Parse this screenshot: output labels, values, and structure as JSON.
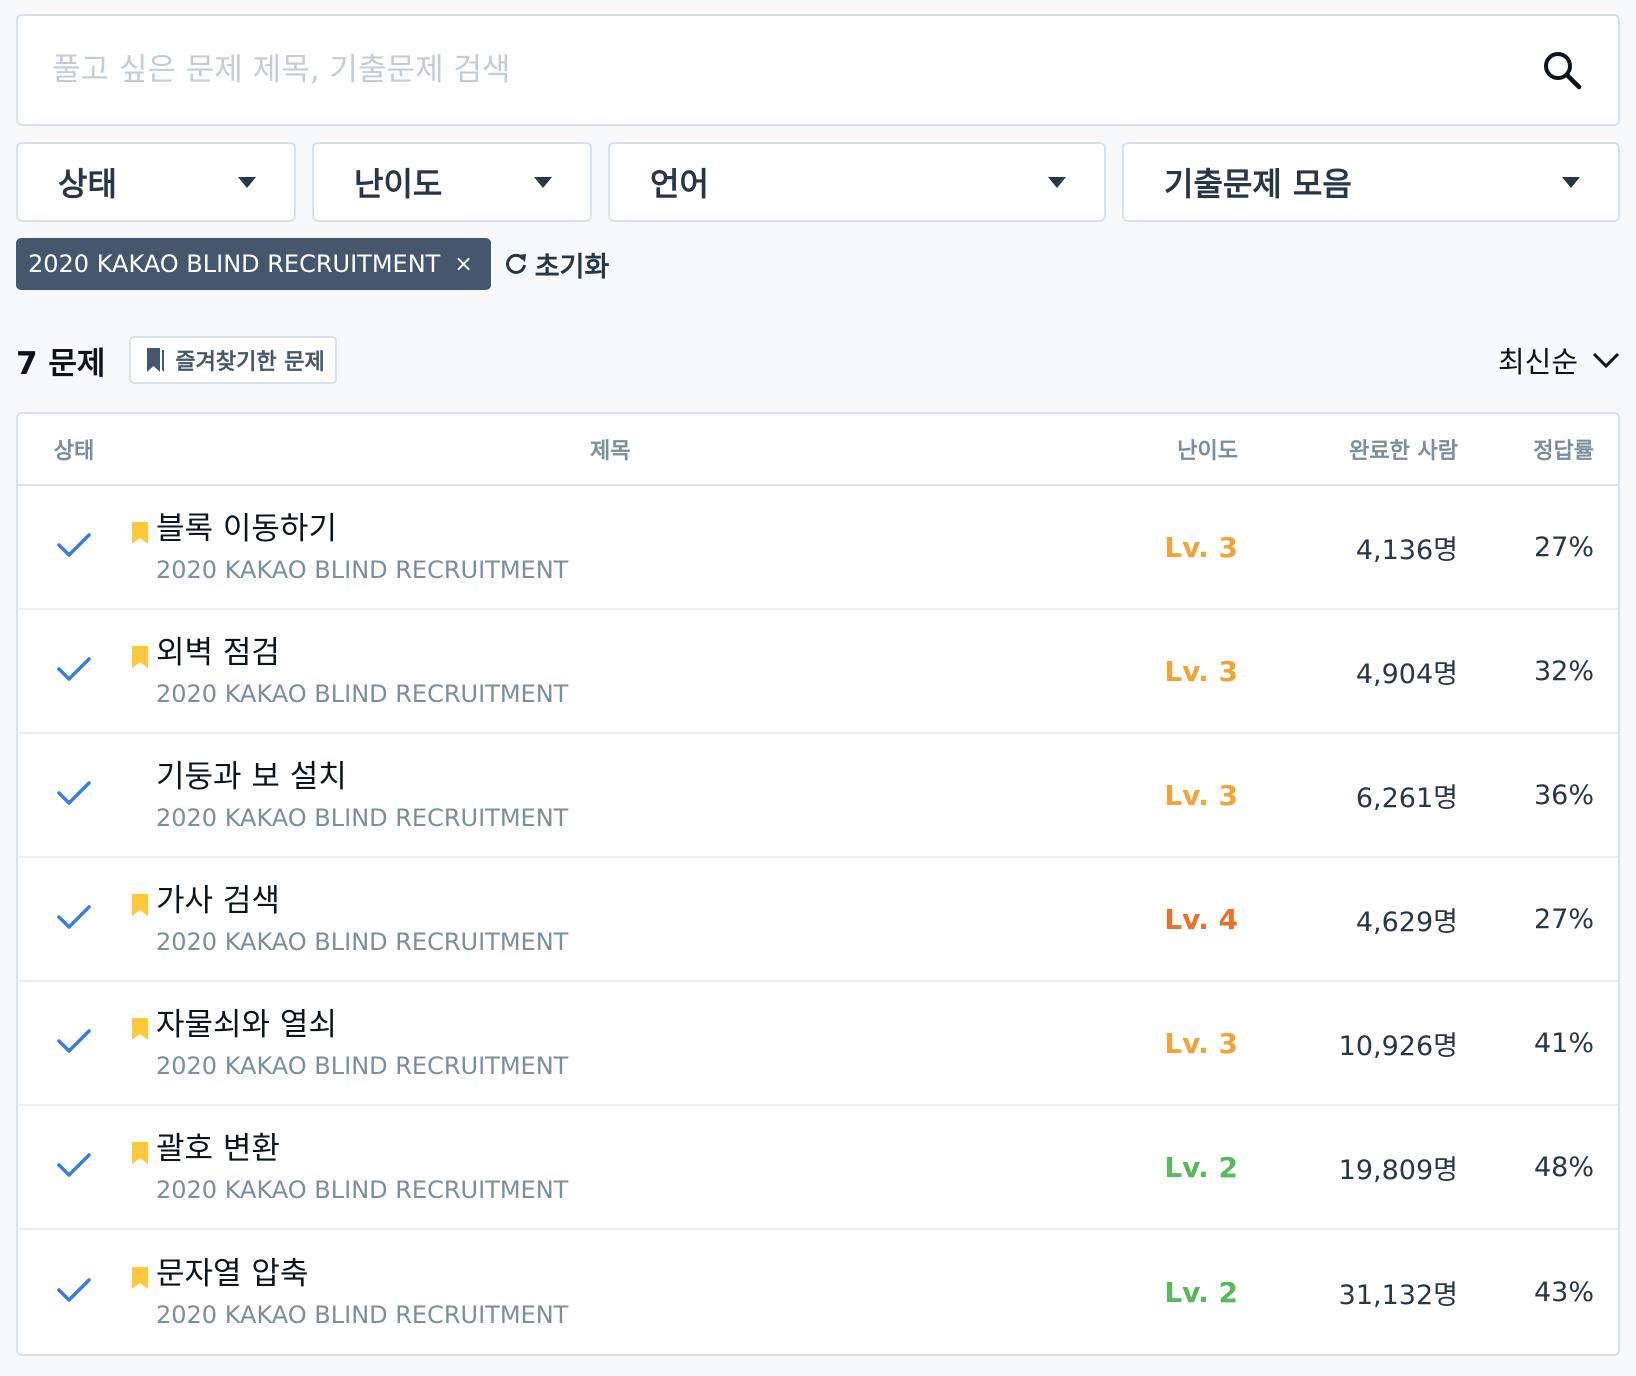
{
  "search": {
    "placeholder": "풀고 싶은 문제 제목, 기출문제 검색"
  },
  "filters": {
    "status": "상태",
    "level": "난이도",
    "language": "언어",
    "past_exams": "기출문제 모음"
  },
  "chip": {
    "label": "2020 KAKAO BLIND RECRUITMENT",
    "remove": "×"
  },
  "reset_label": "초기화",
  "summary": {
    "count": "7 문제",
    "favorites": "즐겨찾기한 문제",
    "sort": "최신순"
  },
  "table": {
    "headers": {
      "status": "상태",
      "title": "제목",
      "level": "난이도",
      "completed": "완료한 사람",
      "rate": "정답률"
    },
    "rows": [
      {
        "title": "블록 이동하기",
        "category": "2020 KAKAO BLIND RECRUITMENT",
        "level": "Lv. 3",
        "completed": "4,136명",
        "rate": "27%",
        "bookmarked": true,
        "level_color": "#f0a53b"
      },
      {
        "title": "외벽 점검",
        "category": "2020 KAKAO BLIND RECRUITMENT",
        "level": "Lv. 3",
        "completed": "4,904명",
        "rate": "32%",
        "bookmarked": true,
        "level_color": "#f0a53b"
      },
      {
        "title": "기둥과 보 설치",
        "category": "2020 KAKAO BLIND RECRUITMENT",
        "level": "Lv. 3",
        "completed": "6,261명",
        "rate": "36%",
        "bookmarked": false,
        "level_color": "#f0a53b"
      },
      {
        "title": "가사 검색",
        "category": "2020 KAKAO BLIND RECRUITMENT",
        "level": "Lv. 4",
        "completed": "4,629명",
        "rate": "27%",
        "bookmarked": true,
        "level_color": "#e8712d"
      },
      {
        "title": "자물쇠와 열쇠",
        "category": "2020 KAKAO BLIND RECRUITMENT",
        "level": "Lv. 3",
        "completed": "10,926명",
        "rate": "41%",
        "bookmarked": true,
        "level_color": "#f0a53b"
      },
      {
        "title": "괄호 변환",
        "category": "2020 KAKAO BLIND RECRUITMENT",
        "level": "Lv. 2",
        "completed": "19,809명",
        "rate": "48%",
        "bookmarked": true,
        "level_color": "#5cb85c"
      },
      {
        "title": "문자열 압축",
        "category": "2020 KAKAO BLIND RECRUITMENT",
        "level": "Lv. 2",
        "completed": "31,132명",
        "rate": "43%",
        "bookmarked": true,
        "level_color": "#5cb85c"
      }
    ]
  },
  "colors": {
    "check": "#3a7de1",
    "bookmark": "#ffc73a"
  }
}
